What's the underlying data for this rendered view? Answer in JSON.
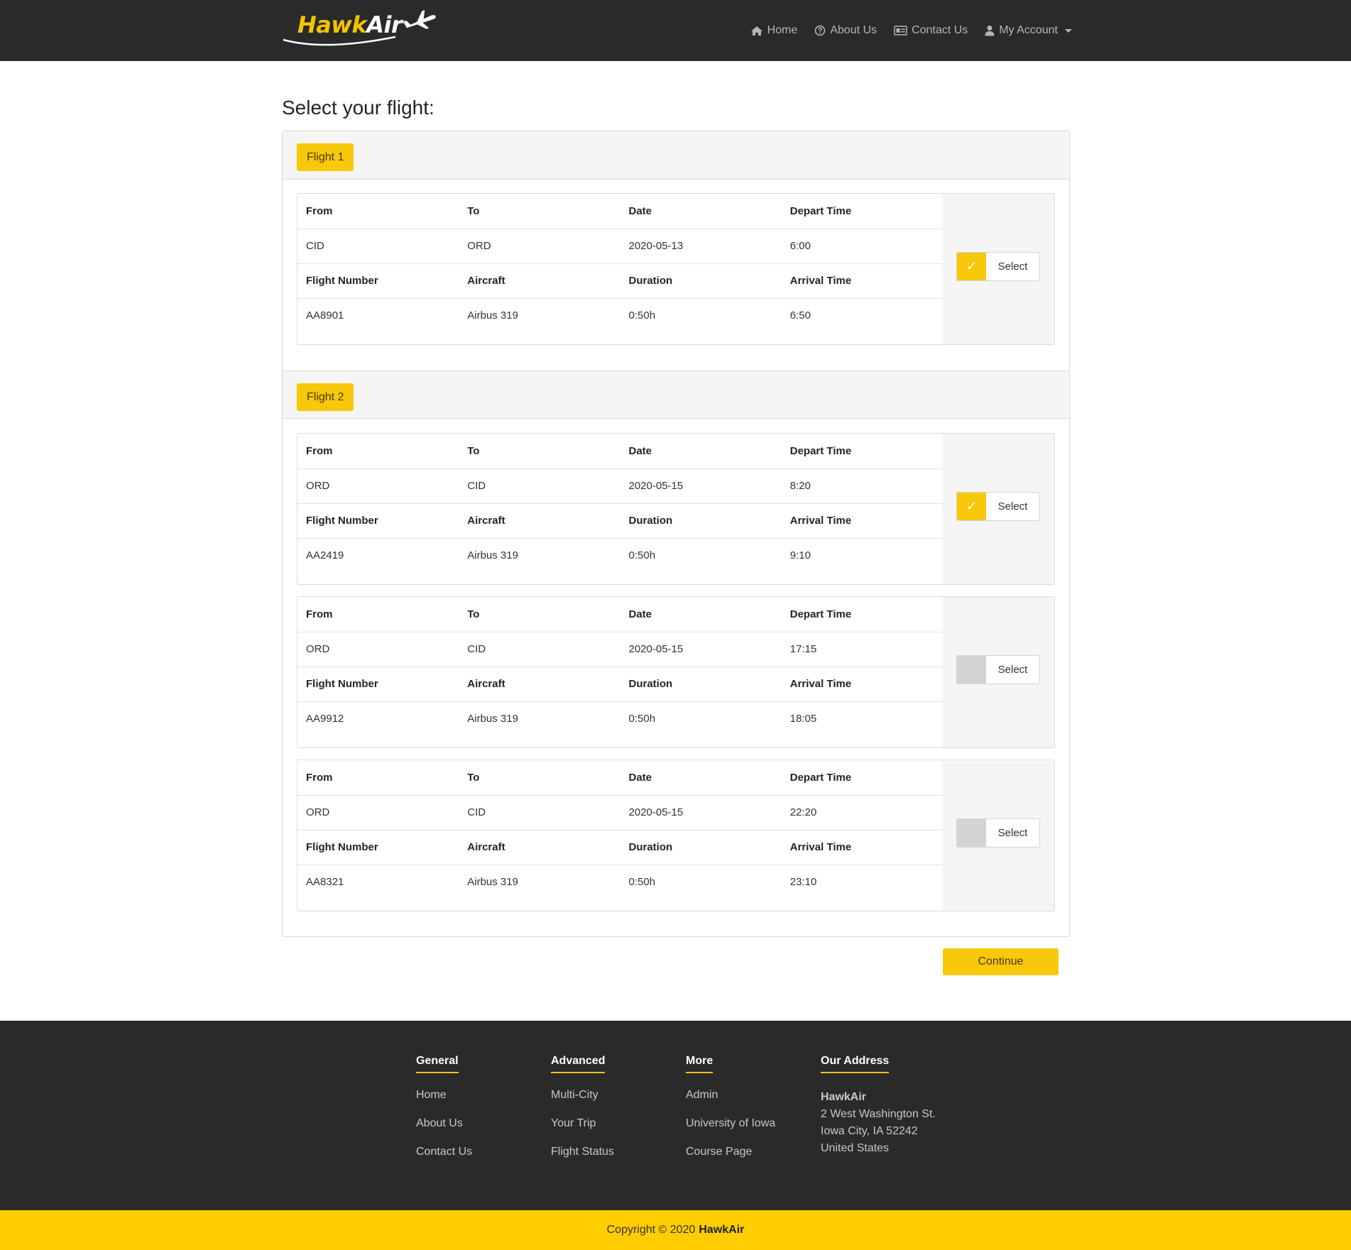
{
  "brand": {
    "name_part1": "Hawk",
    "name_part2": "Air"
  },
  "nav": {
    "home": "Home",
    "about": "About Us",
    "contact": "Contact Us",
    "account": "My Account"
  },
  "page": {
    "title": "Select your flight:"
  },
  "labels": {
    "from": "From",
    "to": "To",
    "date": "Date",
    "depart_time": "Depart Time",
    "flight_number": "Flight Number",
    "aircraft": "Aircraft",
    "duration": "Duration",
    "arrival_time": "Arrival Time",
    "select": "Select",
    "check_glyph": "✓"
  },
  "groups": [
    {
      "label": "Flight 1",
      "options": [
        {
          "from": "CID",
          "to": "ORD",
          "date": "2020-05-13",
          "depart": "6:00",
          "flight_number": "AA8901",
          "aircraft": "Airbus 319",
          "duration": "0:50h",
          "arrival": "6:50",
          "selected": true
        }
      ]
    },
    {
      "label": "Flight 2",
      "options": [
        {
          "from": "ORD",
          "to": "CID",
          "date": "2020-05-15",
          "depart": "8:20",
          "flight_number": "AA2419",
          "aircraft": "Airbus 319",
          "duration": "0:50h",
          "arrival": "9:10",
          "selected": true
        },
        {
          "from": "ORD",
          "to": "CID",
          "date": "2020-05-15",
          "depart": "17:15",
          "flight_number": "AA9912",
          "aircraft": "Airbus 319",
          "duration": "0:50h",
          "arrival": "18:05",
          "selected": false
        },
        {
          "from": "ORD",
          "to": "CID",
          "date": "2020-05-15",
          "depart": "22:20",
          "flight_number": "AA8321",
          "aircraft": "Airbus 319",
          "duration": "0:50h",
          "arrival": "23:10",
          "selected": false
        }
      ]
    }
  ],
  "continue_label": "Continue",
  "footer": {
    "general": {
      "title": "General",
      "links": [
        "Home",
        "About Us",
        "Contact Us"
      ]
    },
    "advanced": {
      "title": "Advanced",
      "links": [
        "Multi-City",
        "Your Trip",
        "Flight Status"
      ]
    },
    "more": {
      "title": "More",
      "links": [
        "Admin",
        "University of Iowa",
        "Course Page"
      ]
    },
    "address": {
      "title": "Our Address",
      "name": "HawkAir",
      "line1": "2 West Washington St.",
      "line2": "Iowa City, IA 52242",
      "line3": "United States"
    },
    "copyright_prefix": "Copyright © 2020",
    "copyright_brand": "HawkAir"
  },
  "colors": {
    "accent": "#f8c80a",
    "navbar": "#2a2a2a",
    "copyright_bar": "#ffcd00"
  },
  "icons": {
    "home": "home-icon",
    "about": "question-circle-icon",
    "contact": "id-card-icon",
    "account": "user-icon",
    "logo": "airplane-icon"
  }
}
